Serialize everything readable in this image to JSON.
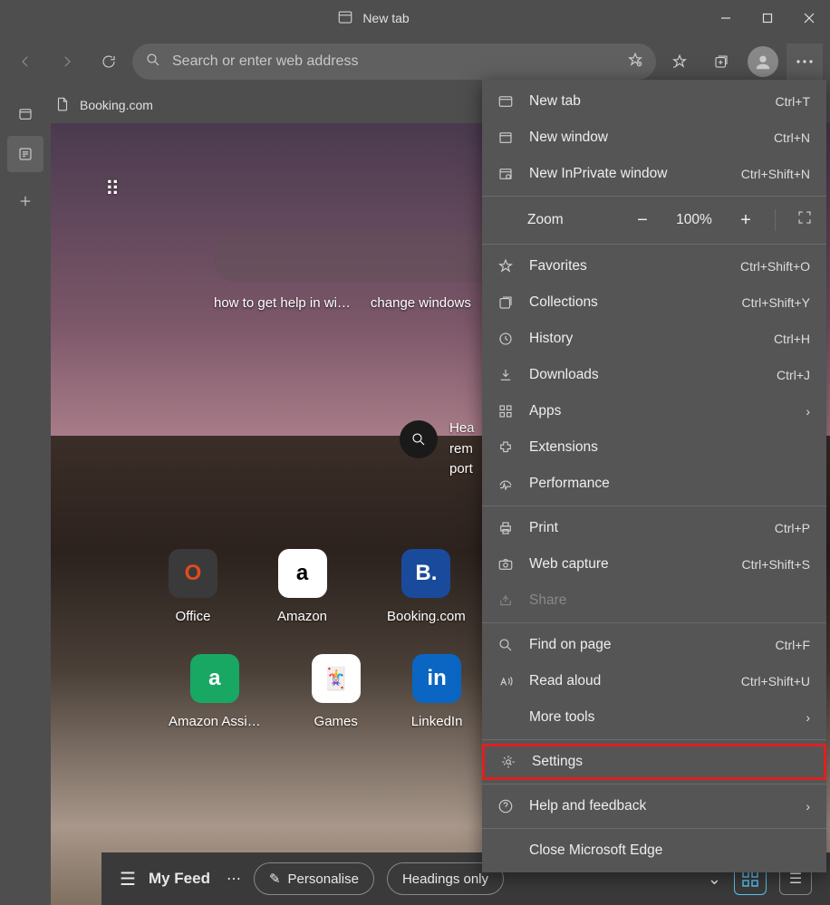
{
  "window": {
    "title": "New tab"
  },
  "address_bar": {
    "placeholder": "Search or enter web address"
  },
  "tab": {
    "label": "Booking.com"
  },
  "suggestions": [
    "how to get help in wi…",
    "change windows"
  ],
  "news": {
    "line1": "Hea",
    "line2": "rem",
    "line3": "port"
  },
  "tiles_row1": [
    {
      "label": "Office",
      "icon": "O",
      "bg": "#3a3a3a",
      "fg": "#e24a1f"
    },
    {
      "label": "Amazon",
      "icon": "a",
      "bg": "#ffffff",
      "fg": "#000"
    },
    {
      "label": "Booking.com",
      "icon": "B.",
      "bg": "#1a4a9c",
      "fg": "#fff"
    }
  ],
  "tiles_row2": [
    {
      "label": "Amazon Assi…",
      "icon": "a",
      "bg": "#18a864",
      "fg": "#fff"
    },
    {
      "label": "Games",
      "icon": "🃏",
      "bg": "#ffffff",
      "fg": "#1a8a3a"
    },
    {
      "label": "LinkedIn",
      "icon": "in",
      "bg": "#0a66c2",
      "fg": "#fff"
    }
  ],
  "feed": {
    "label": "My Feed",
    "personalise": "Personalise",
    "headings": "Headings only"
  },
  "menu": {
    "new_tab": {
      "label": "New tab",
      "shortcut": "Ctrl+T"
    },
    "new_window": {
      "label": "New window",
      "shortcut": "Ctrl+N"
    },
    "inprivate": {
      "label": "New InPrivate window",
      "shortcut": "Ctrl+Shift+N"
    },
    "zoom": {
      "label": "Zoom",
      "value": "100%"
    },
    "favorites": {
      "label": "Favorites",
      "shortcut": "Ctrl+Shift+O"
    },
    "collections": {
      "label": "Collections",
      "shortcut": "Ctrl+Shift+Y"
    },
    "history": {
      "label": "History",
      "shortcut": "Ctrl+H"
    },
    "downloads": {
      "label": "Downloads",
      "shortcut": "Ctrl+J"
    },
    "apps": {
      "label": "Apps"
    },
    "extensions": {
      "label": "Extensions"
    },
    "performance": {
      "label": "Performance"
    },
    "print": {
      "label": "Print",
      "shortcut": "Ctrl+P"
    },
    "web_capture": {
      "label": "Web capture",
      "shortcut": "Ctrl+Shift+S"
    },
    "share": {
      "label": "Share"
    },
    "find": {
      "label": "Find on page",
      "shortcut": "Ctrl+F"
    },
    "read_aloud": {
      "label": "Read aloud",
      "shortcut": "Ctrl+Shift+U"
    },
    "more_tools": {
      "label": "More tools"
    },
    "settings": {
      "label": "Settings"
    },
    "help": {
      "label": "Help and feedback"
    },
    "close": {
      "label": "Close Microsoft Edge"
    }
  }
}
